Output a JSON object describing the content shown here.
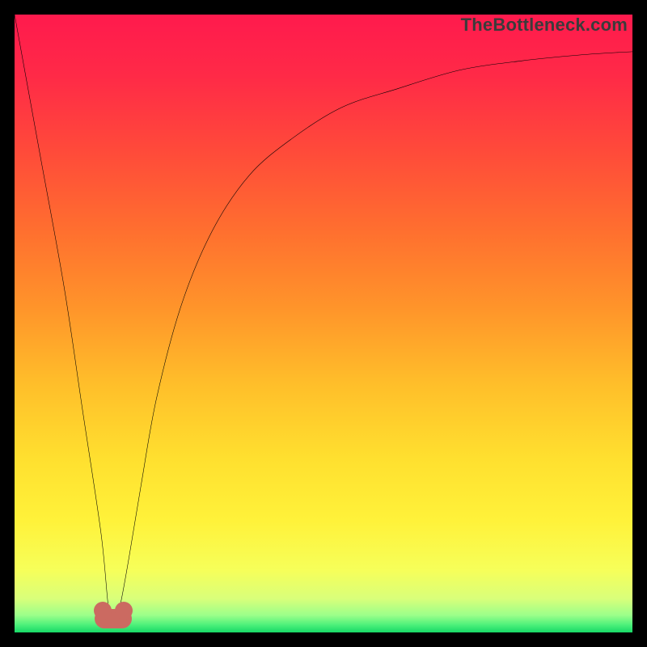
{
  "watermark": {
    "text": "TheBottleneck.com"
  },
  "colors": {
    "frame": "#000000",
    "curve_stroke": "#000000",
    "bump": "#cb6a61",
    "gradient_stops": [
      {
        "offset": 0.0,
        "color": "#ff1a4d"
      },
      {
        "offset": 0.1,
        "color": "#ff2a47"
      },
      {
        "offset": 0.22,
        "color": "#ff4a3a"
      },
      {
        "offset": 0.35,
        "color": "#ff6f2f"
      },
      {
        "offset": 0.48,
        "color": "#ff962a"
      },
      {
        "offset": 0.6,
        "color": "#ffbf2a"
      },
      {
        "offset": 0.72,
        "color": "#ffe02f"
      },
      {
        "offset": 0.82,
        "color": "#fff23a"
      },
      {
        "offset": 0.9,
        "color": "#f6ff5a"
      },
      {
        "offset": 0.945,
        "color": "#d9ff7a"
      },
      {
        "offset": 0.972,
        "color": "#9cff8a"
      },
      {
        "offset": 0.988,
        "color": "#4cf07a"
      },
      {
        "offset": 1.0,
        "color": "#17d867"
      }
    ]
  },
  "chart_data": {
    "type": "line",
    "title": "",
    "xlabel": "",
    "ylabel": "",
    "xlim": [
      0,
      100
    ],
    "ylim": [
      0,
      100
    ],
    "grid": false,
    "legend": false,
    "annotations": [
      "TheBottleneck.com"
    ],
    "series": [
      {
        "name": "bottleneck-curve",
        "x": [
          0,
          4,
          8,
          11,
          14,
          15.2,
          16,
          17,
          18.5,
          20.5,
          23,
          27,
          32,
          38,
          45,
          53,
          62,
          72,
          82,
          92,
          100
        ],
        "y": [
          100,
          78,
          56,
          36,
          16,
          4,
          2,
          4,
          12,
          24,
          38,
          53,
          65,
          74,
          80,
          85,
          88,
          91,
          92.5,
          93.5,
          94
        ]
      }
    ],
    "marker": {
      "name": "minimum-bump",
      "x": 16,
      "y": 2,
      "width_pct": 6
    },
    "note": "Values are read off the pixel positions; axes are implicit 0–100 in both directions with y increasing upward. The curve drops steeply from top-left to a minimum near x≈16, then rises asymptotically toward ~94 at the right edge."
  }
}
